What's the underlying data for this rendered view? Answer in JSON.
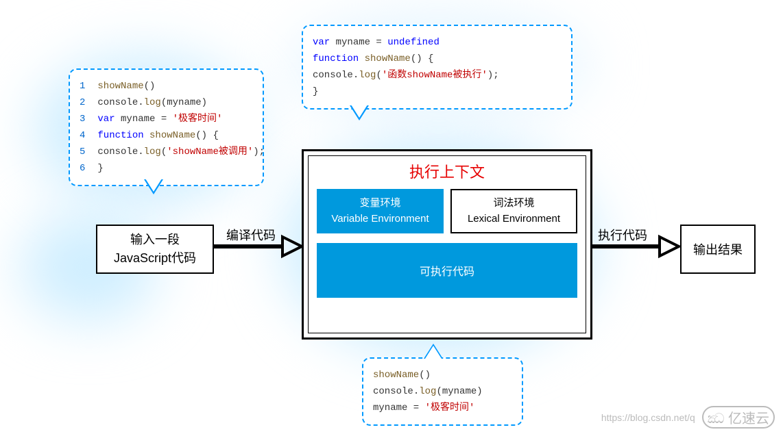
{
  "source_code": {
    "lines": [
      {
        "n": "1",
        "tokens": [
          {
            "c": "fn",
            "t": "showName"
          },
          {
            "c": "op",
            "t": "()"
          }
        ]
      },
      {
        "n": "2",
        "tokens": [
          {
            "c": "id",
            "t": "console"
          },
          {
            "c": "op",
            "t": "."
          },
          {
            "c": "fn",
            "t": "log"
          },
          {
            "c": "op",
            "t": "(myname)"
          }
        ]
      },
      {
        "n": "3",
        "tokens": [
          {
            "c": "kw",
            "t": "var "
          },
          {
            "c": "id",
            "t": "myname = "
          },
          {
            "c": "str",
            "t": "'极客时间'"
          }
        ]
      },
      {
        "n": "4",
        "tokens": [
          {
            "c": "kw",
            "t": "function "
          },
          {
            "c": "fn",
            "t": "showName"
          },
          {
            "c": "op",
            "t": "() {"
          }
        ]
      },
      {
        "n": "5",
        "tokens": [
          {
            "c": "op",
            "t": "    "
          },
          {
            "c": "id",
            "t": "console"
          },
          {
            "c": "op",
            "t": "."
          },
          {
            "c": "fn",
            "t": "log"
          },
          {
            "c": "op",
            "t": "("
          },
          {
            "c": "str",
            "t": "'showName被调用'"
          },
          {
            "c": "op",
            "t": ");"
          }
        ]
      },
      {
        "n": "6",
        "tokens": [
          {
            "c": "op",
            "t": "}"
          }
        ]
      }
    ]
  },
  "var_env_code": {
    "lines": [
      {
        "tokens": [
          {
            "c": "kw",
            "t": "var "
          },
          {
            "c": "id",
            "t": "myname = "
          },
          {
            "c": "kw",
            "t": "undefined"
          }
        ]
      },
      {
        "tokens": [
          {
            "c": "kw",
            "t": "function "
          },
          {
            "c": "fn",
            "t": "showName"
          },
          {
            "c": "op",
            "t": "() {"
          }
        ]
      },
      {
        "tokens": [
          {
            "c": "op",
            "t": "    "
          },
          {
            "c": "id",
            "t": "console"
          },
          {
            "c": "op",
            "t": "."
          },
          {
            "c": "fn",
            "t": "log"
          },
          {
            "c": "op",
            "t": "("
          },
          {
            "c": "str",
            "t": "'函数showName被执行'"
          },
          {
            "c": "op",
            "t": ");"
          }
        ]
      },
      {
        "tokens": [
          {
            "c": "op",
            "t": "}"
          }
        ]
      }
    ]
  },
  "exec_code": {
    "lines": [
      {
        "tokens": [
          {
            "c": "fn",
            "t": "showName"
          },
          {
            "c": "op",
            "t": "()"
          }
        ]
      },
      {
        "tokens": [
          {
            "c": "id",
            "t": "console"
          },
          {
            "c": "op",
            "t": "."
          },
          {
            "c": "fn",
            "t": "log"
          },
          {
            "c": "op",
            "t": "(myname)"
          }
        ]
      },
      {
        "tokens": [
          {
            "c": "id",
            "t": "myname = "
          },
          {
            "c": "str",
            "t": "'极客时间'"
          }
        ]
      }
    ]
  },
  "input_box": {
    "line1": "输入一段",
    "line2": "JavaScript代码"
  },
  "arrow1_label": "编译代码",
  "arrow2_label": "执行代码",
  "context": {
    "title": "执行上下文",
    "var_env": {
      "cn": "变量环境",
      "en": "Variable Environment"
    },
    "lex_env": {
      "cn": "词法环境",
      "en": "Lexical Environment"
    },
    "executable": "可执行代码"
  },
  "output_box": "输出结果",
  "watermark": {
    "url": "https://blog.csdn.net/q",
    "brand": "亿速云"
  }
}
